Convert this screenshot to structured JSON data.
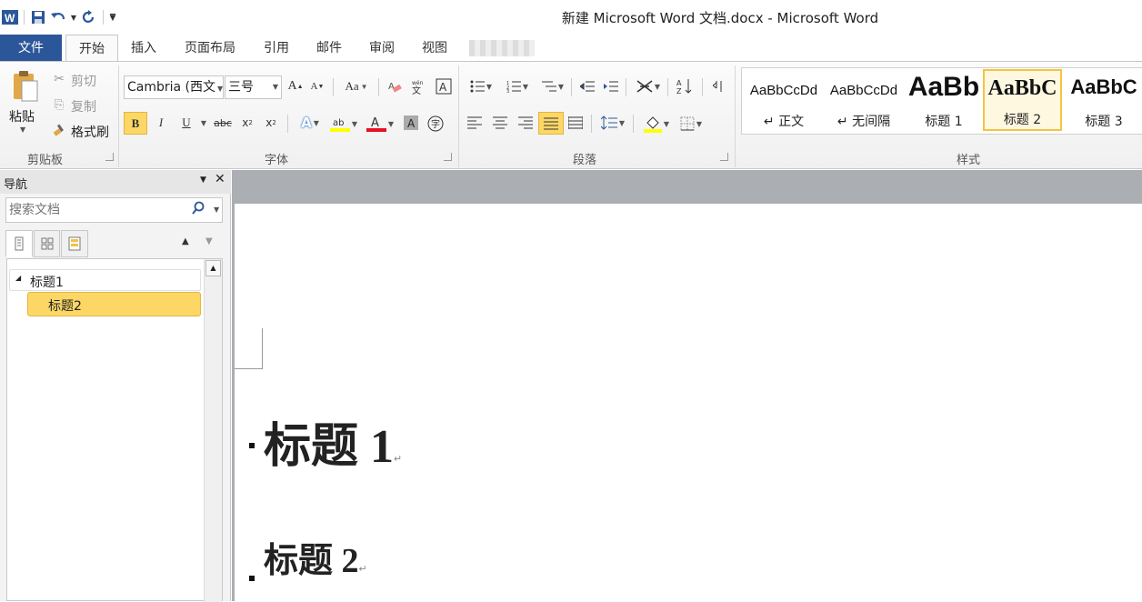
{
  "window": {
    "title": "新建 Microsoft Word 文档.docx - Microsoft Word"
  },
  "quick_access": {
    "icons": [
      "word-logo-icon",
      "save-icon",
      "undo-icon",
      "redo-icon",
      "customize-icon"
    ]
  },
  "tabs": [
    {
      "label": "文件"
    },
    {
      "label": "开始"
    },
    {
      "label": "插入"
    },
    {
      "label": "页面布局"
    },
    {
      "label": "引用"
    },
    {
      "label": "邮件"
    },
    {
      "label": "审阅"
    },
    {
      "label": "视图"
    }
  ],
  "clipboard": {
    "paste": "粘贴",
    "cut": "剪切",
    "copy": "复制",
    "format_painter": "格式刷",
    "group": "剪贴板"
  },
  "font": {
    "name": "Cambria (西文",
    "size": "三号",
    "group": "字体",
    "bold": "B",
    "italic": "I",
    "underline": "U",
    "strike": "abc",
    "grow": "A",
    "shrink": "A",
    "case": "Aa",
    "font_color": "#e81123",
    "highlight_color": "#ffff00"
  },
  "paragraph": {
    "group": "段落"
  },
  "styles": {
    "group": "样式",
    "items": [
      {
        "sample": "AaBbCcDd",
        "name": "↵ 正文"
      },
      {
        "sample": "AaBbCcDd",
        "name": "↵ 无间隔"
      },
      {
        "sample": "AaBb",
        "name": "标题 1"
      },
      {
        "sample": "AaBbC",
        "name": "标题 2"
      },
      {
        "sample": "AaBbC",
        "name": "标题 3"
      }
    ],
    "selected_color": "#f5c242"
  },
  "nav": {
    "title": "导航",
    "search_placeholder": "搜索文档",
    "items": [
      {
        "label": "标题1"
      },
      {
        "label": "标题2"
      }
    ],
    "selected_color": "#fcd766"
  },
  "document": {
    "heading1": "标题 1",
    "heading2": "标题 2",
    "para_mark": "↵"
  }
}
